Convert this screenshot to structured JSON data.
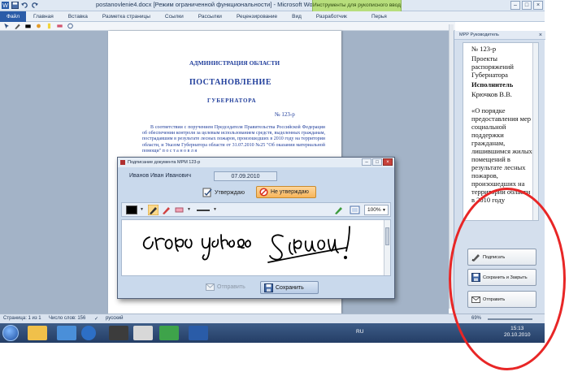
{
  "window": {
    "title": "postanovlenie4.docx [Режим ограниченной функциональности] - Microsoft Word",
    "context_group": "Инструменты для рукописного ввода"
  },
  "ribbon": {
    "tabs": [
      "Файл",
      "Главная",
      "Вставка",
      "Разметка страницы",
      "Ссылки",
      "Рассылки",
      "Рецензирование",
      "Вид",
      "Разработчик"
    ],
    "context_tab": "Перья"
  },
  "document": {
    "org": "АДМИНИСТРАЦИЯ ОБЛАСТИ",
    "doc_type": "ПОСТАНОВЛЕНИЕ",
    "author": "ГУБЕРНАТОРА",
    "number": "№ 123-р",
    "body": "В соответствии с поручением Председателя Правительства Российской Федерации об обеспечении контроля за целевым использованием средств, выделенных гражданам, пострадавшим в результате лесных пожаров, произошедших в 2010 году на территории области, и Указом Губернатора области от 31.07.2010 №25 \"Об оказании материальной помощи\"   п о с т а н о в л я"
  },
  "task_pane": {
    "title": "МРР Руководитель",
    "lines": [
      "№ 123-р",
      "Проекты распоряжений Губернатора",
      "Исполнитель",
      "Крючков В.В.",
      "«О порядке предоставления мер социальной поддержки гражданам, лишившимся жилых помещений в результате лесных пожаров, произошедших на территории области в 2010 году"
    ],
    "buttons": {
      "sign": "Подписать",
      "save_close": "Сохранить и Закрыть",
      "send": "Отправить"
    }
  },
  "dialog": {
    "title": "Подписание документа МРМ 123-р",
    "signer": "Иванов Иван Иванович",
    "date": "07.09.2010",
    "approve_label": "Утверждаю",
    "reject_label": "Не утверждаю",
    "zoom": "100%",
    "send_label": "Отправить",
    "save_label": "Сохранить"
  },
  "statusbar": {
    "page": "Страница: 1 из 1",
    "words": "Число слов: 156",
    "language": "русский",
    "zoom": "69%"
  },
  "taskbar": {
    "language": "RU",
    "time": "15:13",
    "date": "20.10.2010"
  }
}
